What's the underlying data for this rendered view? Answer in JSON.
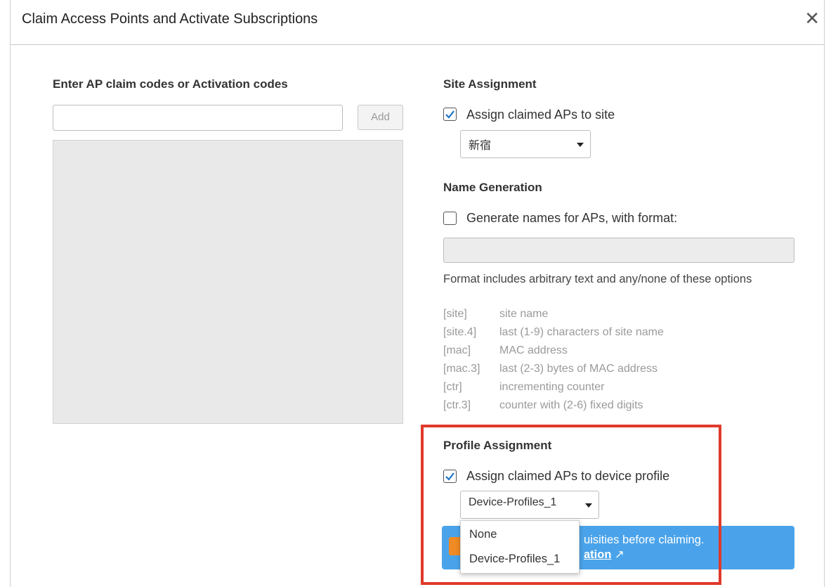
{
  "dialog": {
    "title": "Claim Access Points and Activate Subscriptions",
    "close_glyph": "✕"
  },
  "codes": {
    "label": "Enter AP claim codes or Activation codes",
    "input_value": "",
    "add_label": "Add"
  },
  "site": {
    "heading": "Site Assignment",
    "checkbox_label": "Assign claimed APs to site",
    "checked": true,
    "selected": "新宿"
  },
  "names": {
    "heading": "Name Generation",
    "checkbox_label": "Generate names for APs, with format:",
    "checked": false,
    "format_value": "",
    "description": "Format includes arbitrary text and any/none of these options",
    "options": [
      {
        "key": "[site]",
        "desc": "site name"
      },
      {
        "key": "[site.4]",
        "desc": "last (1-9) characters of site name"
      },
      {
        "key": "[mac]",
        "desc": "MAC address"
      },
      {
        "key": "[mac.3]",
        "desc": "last (2-3) bytes of MAC address"
      },
      {
        "key": "[ctr]",
        "desc": "incrementing counter"
      },
      {
        "key": "[ctr.3]",
        "desc": "counter with (2-6) fixed digits"
      }
    ]
  },
  "profile": {
    "heading": "Profile Assignment",
    "checkbox_label": "Assign claimed APs to device profile",
    "checked": true,
    "selected": "Device-Profiles_1",
    "dropdown_options": [
      "None",
      "Device-Profiles_1"
    ]
  },
  "banner": {
    "line1": "uisities before claiming.",
    "link_text": "ation",
    "link_icon": "↗"
  },
  "colors": {
    "highlight": "#e0392b",
    "banner": "#4aa3ea",
    "check": "#1a73c7"
  }
}
